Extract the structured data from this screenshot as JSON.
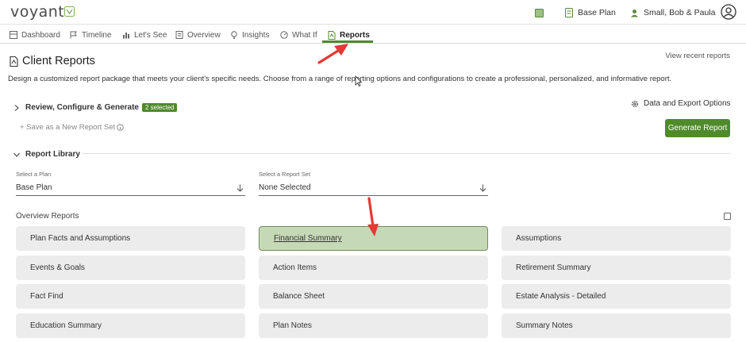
{
  "header": {
    "logo": "voyant",
    "plan_button": "Base Plan",
    "client_button": "Small, Bob & Paula"
  },
  "nav": {
    "tabs": [
      {
        "label": "Dashboard",
        "icon": "dashboard-icon"
      },
      {
        "label": "Timeline",
        "icon": "flag-icon"
      },
      {
        "label": "Let's See",
        "icon": "bar-chart-icon"
      },
      {
        "label": "Overview",
        "icon": "document-icon"
      },
      {
        "label": "Insights",
        "icon": "lightbulb-icon"
      },
      {
        "label": "What If",
        "icon": "gauge-icon"
      },
      {
        "label": "Reports",
        "icon": "report-icon",
        "active": true
      }
    ]
  },
  "page": {
    "title": "Client Reports",
    "view_recent": "View recent reports",
    "intro": "Design a customized report package that meets your client's specific needs. Choose from a range of reporting options and configurations to create a professional, personalized, and informative report."
  },
  "review": {
    "label": "Review, Configure & Generate",
    "badge": "2 selected",
    "save_set": "+ Save as a New Report Set",
    "data_export": "Data and Export Options",
    "generate": "Generate Report"
  },
  "library": {
    "label": "Report Library",
    "plan_select": {
      "label": "Select a Plan",
      "value": "Base Plan"
    },
    "set_select": {
      "label": "Select a Report Set",
      "value": "None Selected"
    },
    "overview_label": "Overview Reports",
    "cards": [
      [
        "Plan Facts and Assumptions",
        "Financial Summary",
        "Assumptions"
      ],
      [
        "Events & Goals",
        "Action Items",
        "Retirement Summary"
      ],
      [
        "Fact Find",
        "Balance Sheet",
        "Estate Analysis - Detailed"
      ],
      [
        "Education Summary",
        "Plan Notes",
        "Summary Notes"
      ]
    ],
    "selected_card": "Financial Summary"
  },
  "colors": {
    "accent": "#4f8a2b",
    "selected_card_bg": "#c6d9b7",
    "card_bg": "#ececec",
    "annotation_arrow": "#e53935"
  }
}
